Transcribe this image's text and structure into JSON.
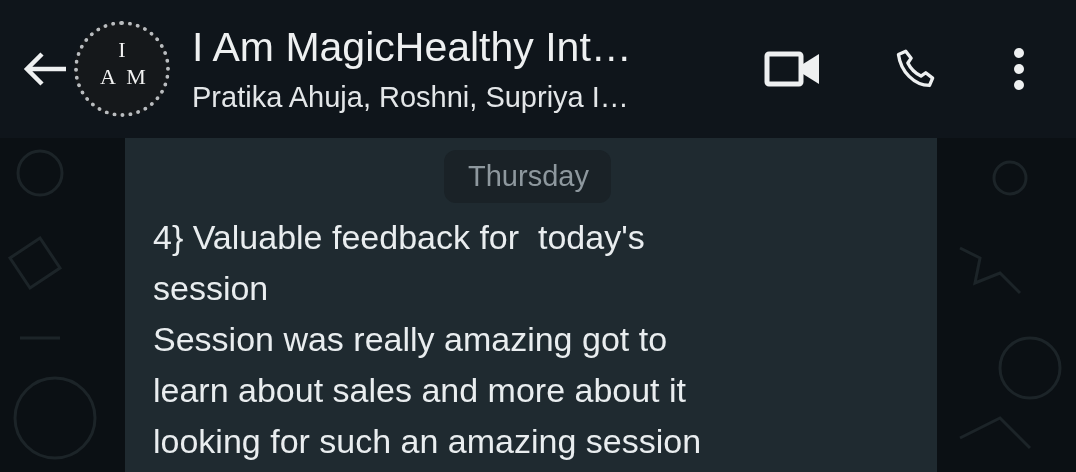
{
  "header": {
    "title": "I Am MagicHealthy Int…",
    "subtitle": "Pratika Ahuja, Roshni, Supriya I…",
    "avatar": {
      "letters": [
        "I",
        "A",
        "M"
      ]
    }
  },
  "date_chip": "Thursday",
  "messages": [
    {
      "kind": "text",
      "text": "4} Valuable feedback for  today's\nsession\nSession was really amazing got to\nlearn about sales and more about it\nlooking for such an amazing session"
    }
  ]
}
